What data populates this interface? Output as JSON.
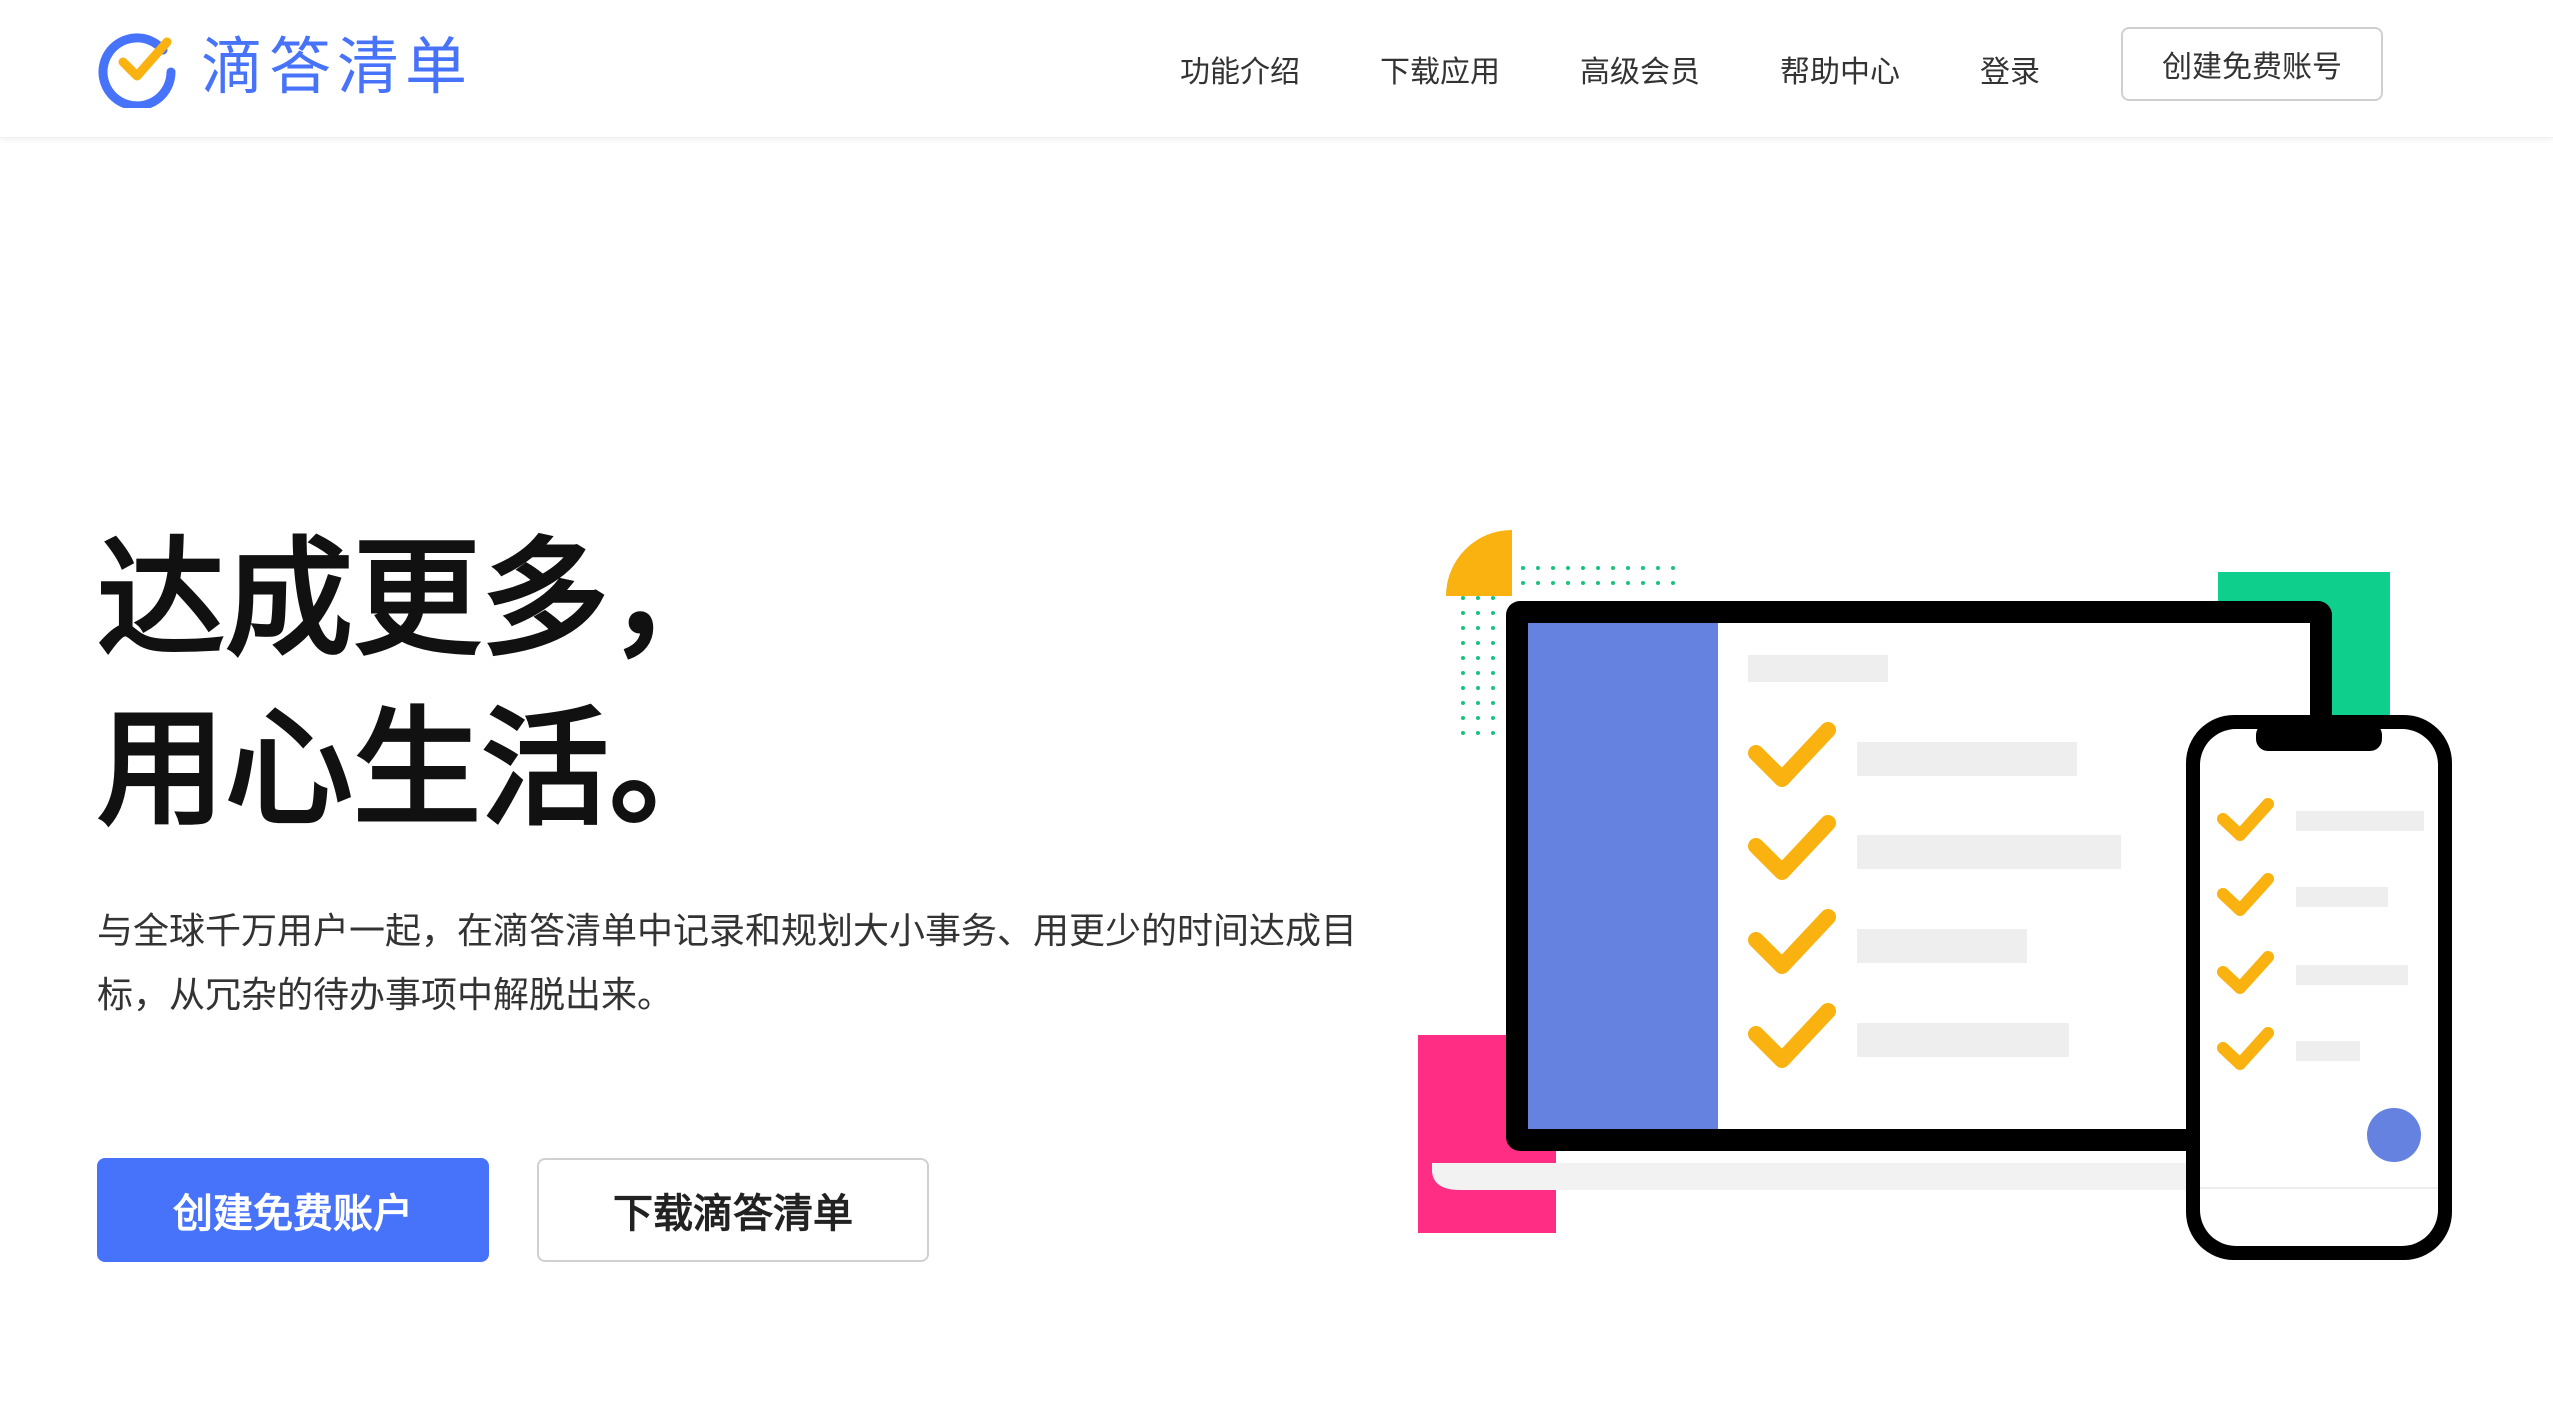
{
  "header": {
    "logo_text": "滴答清单",
    "nav": [
      "功能介绍",
      "下载应用",
      "高级会员",
      "帮助中心",
      "登录"
    ],
    "cta": "创建免费账号"
  },
  "hero": {
    "title_line1": "达成更多，",
    "title_line2": "用心生活。",
    "subtitle": "与全球千万用户一起，在滴答清单中记录和规划大小事务、用更少的时间达成目标，从冗杂的待办事项中解脱出来。",
    "primary_button": "创建免费账户",
    "secondary_button": "下载滴答清单"
  },
  "colors": {
    "brand_blue": "#4772fa",
    "sidebar_blue": "#6582e0",
    "check_yellow": "#f9b20f",
    "accent_green": "#0fcf8c",
    "accent_pink": "#ff2e84",
    "placeholder_gray": "#eeeeee"
  }
}
